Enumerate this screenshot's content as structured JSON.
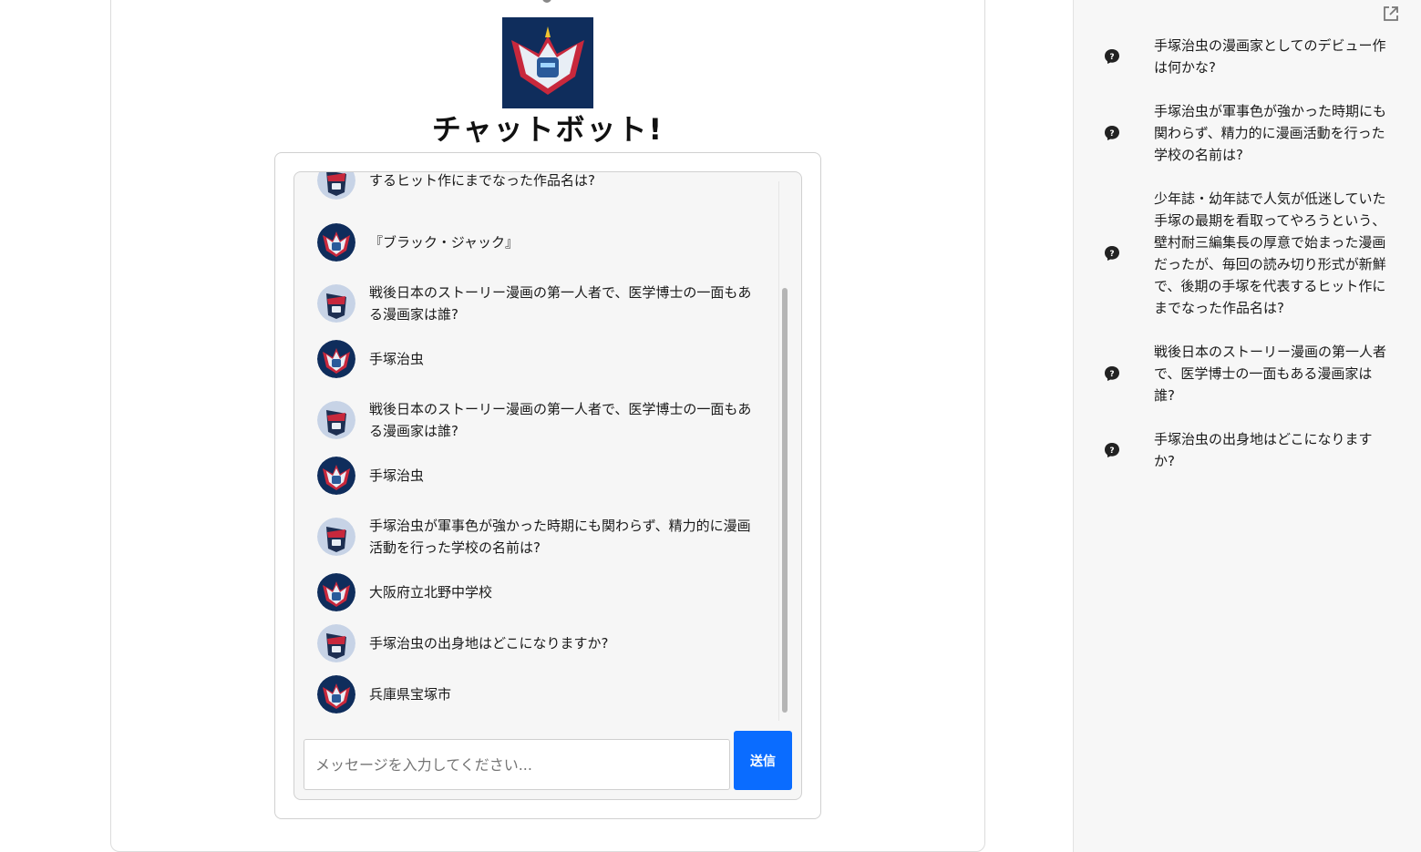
{
  "app": {
    "title": "チャットボット!"
  },
  "chat": {
    "messages": [
      {
        "role": "user",
        "text": "するヒット作にまでなった作品名は?"
      },
      {
        "role": "bot",
        "text": "『ブラック・ジャック』"
      },
      {
        "role": "user",
        "text": "戦後日本のストーリー漫画の第一人者で、医学博士の一面もある漫画家は誰?"
      },
      {
        "role": "bot",
        "text": "手塚治虫"
      },
      {
        "role": "user",
        "text": "戦後日本のストーリー漫画の第一人者で、医学博士の一面もある漫画家は誰?"
      },
      {
        "role": "bot",
        "text": "手塚治虫"
      },
      {
        "role": "user",
        "text": "手塚治虫が軍事色が強かった時期にも関わらず、精力的に漫画活動を行った学校の名前は?"
      },
      {
        "role": "bot",
        "text": "大阪府立北野中学校"
      },
      {
        "role": "user",
        "text": "手塚治虫の出身地はどこになりますか?"
      },
      {
        "role": "bot",
        "text": "兵庫県宝塚市"
      }
    ],
    "input_placeholder": "メッセージを入力してください...",
    "send_label": "送信"
  },
  "sidebar": {
    "questions": [
      {
        "text": "手塚治虫の漫画家としてのデビュー作は何かな?"
      },
      {
        "text": "手塚治虫が軍事色が強かった時期にも関わらず、精力的に漫画活動を行った学校の名前は?"
      },
      {
        "text": "少年誌・幼年誌で人気が低迷していた手塚の最期を看取ってやろうという、壁村耐三編集長の厚意で始まった漫画だったが、毎回の読み切り形式が新鮮で、後期の手塚を代表するヒット作にまでなった作品名は?"
      },
      {
        "text": "戦後日本のストーリー漫画の第一人者で、医学博士の一面もある漫画家は誰?"
      },
      {
        "text": "手塚治虫の出身地はどこになりますか?"
      }
    ]
  },
  "colors": {
    "accent": "#0a6cff",
    "logo_bg": "#0f2d5c"
  }
}
